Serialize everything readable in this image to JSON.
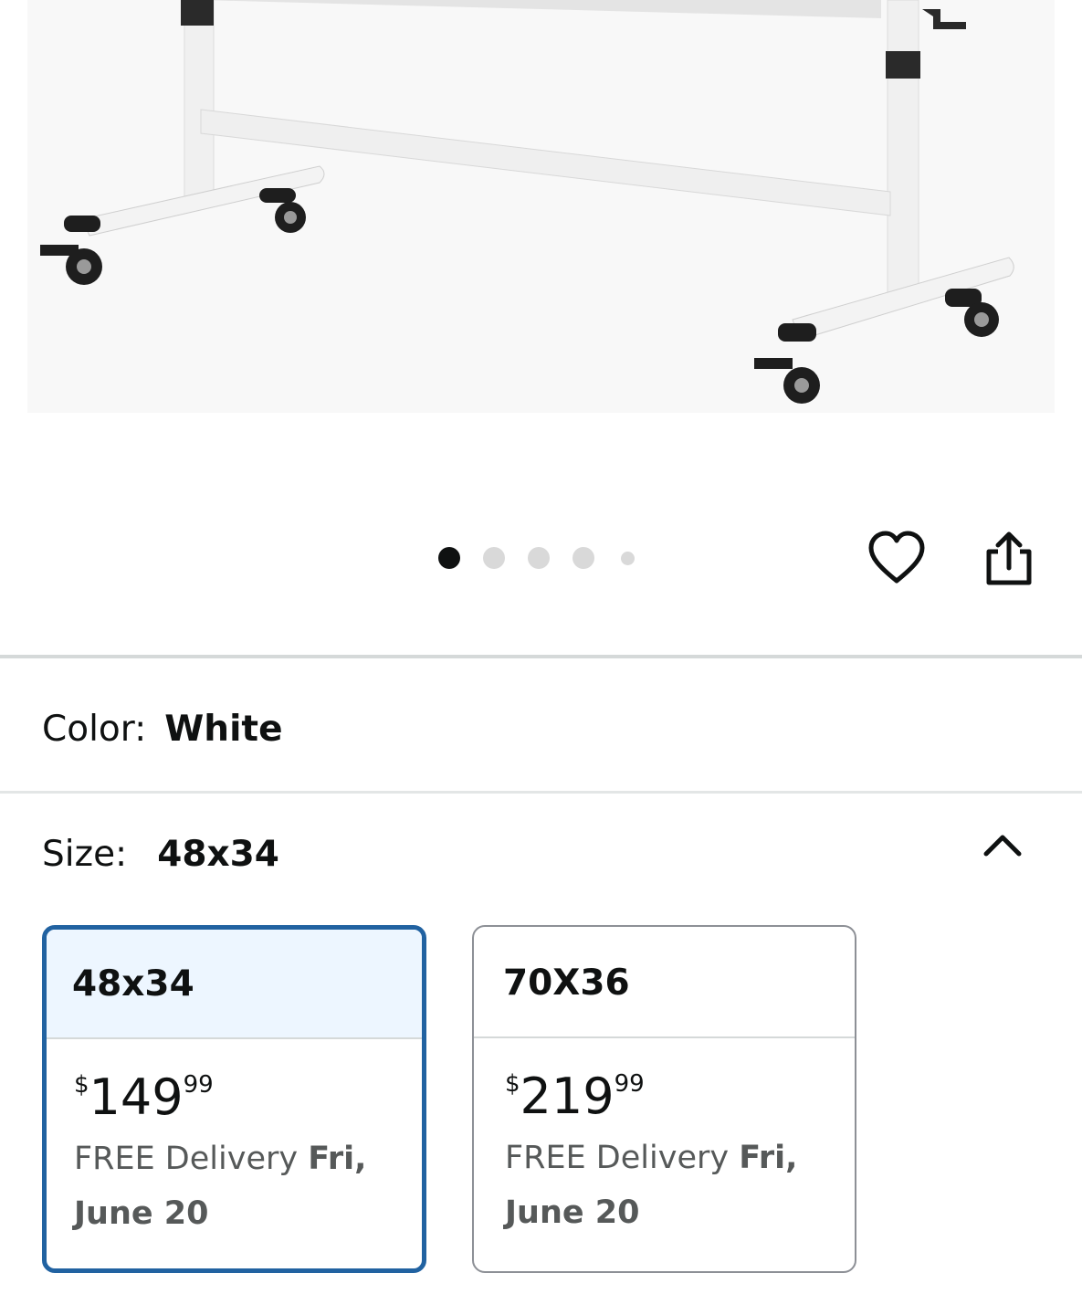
{
  "gallery": {
    "image_alt": "mobile whiteboard stand with locking caster wheels",
    "dot_count": 5,
    "active_index": 0
  },
  "actions": {
    "favorite_icon": "heart-icon",
    "share_icon": "share-icon"
  },
  "color": {
    "label": "Color:",
    "value": "White"
  },
  "size": {
    "label": "Size:",
    "value": "48x34",
    "toggle_icon": "chevron-up-icon",
    "options": [
      {
        "name": "48x34",
        "currency": "$",
        "price_whole": "149",
        "price_fraction": "99",
        "delivery_prefix": "FREE Delivery ",
        "delivery_date": "Fri, June 20",
        "selected": true
      },
      {
        "name": "70X36",
        "currency": "$",
        "price_whole": "219",
        "price_fraction": "99",
        "delivery_prefix": "FREE Delivery ",
        "delivery_date": "Fri, June 20",
        "selected": false
      }
    ]
  },
  "colors": {
    "selected_border": "#2162a1",
    "selected_header_bg": "#edf6ff",
    "divider": "#d5d9d9"
  }
}
